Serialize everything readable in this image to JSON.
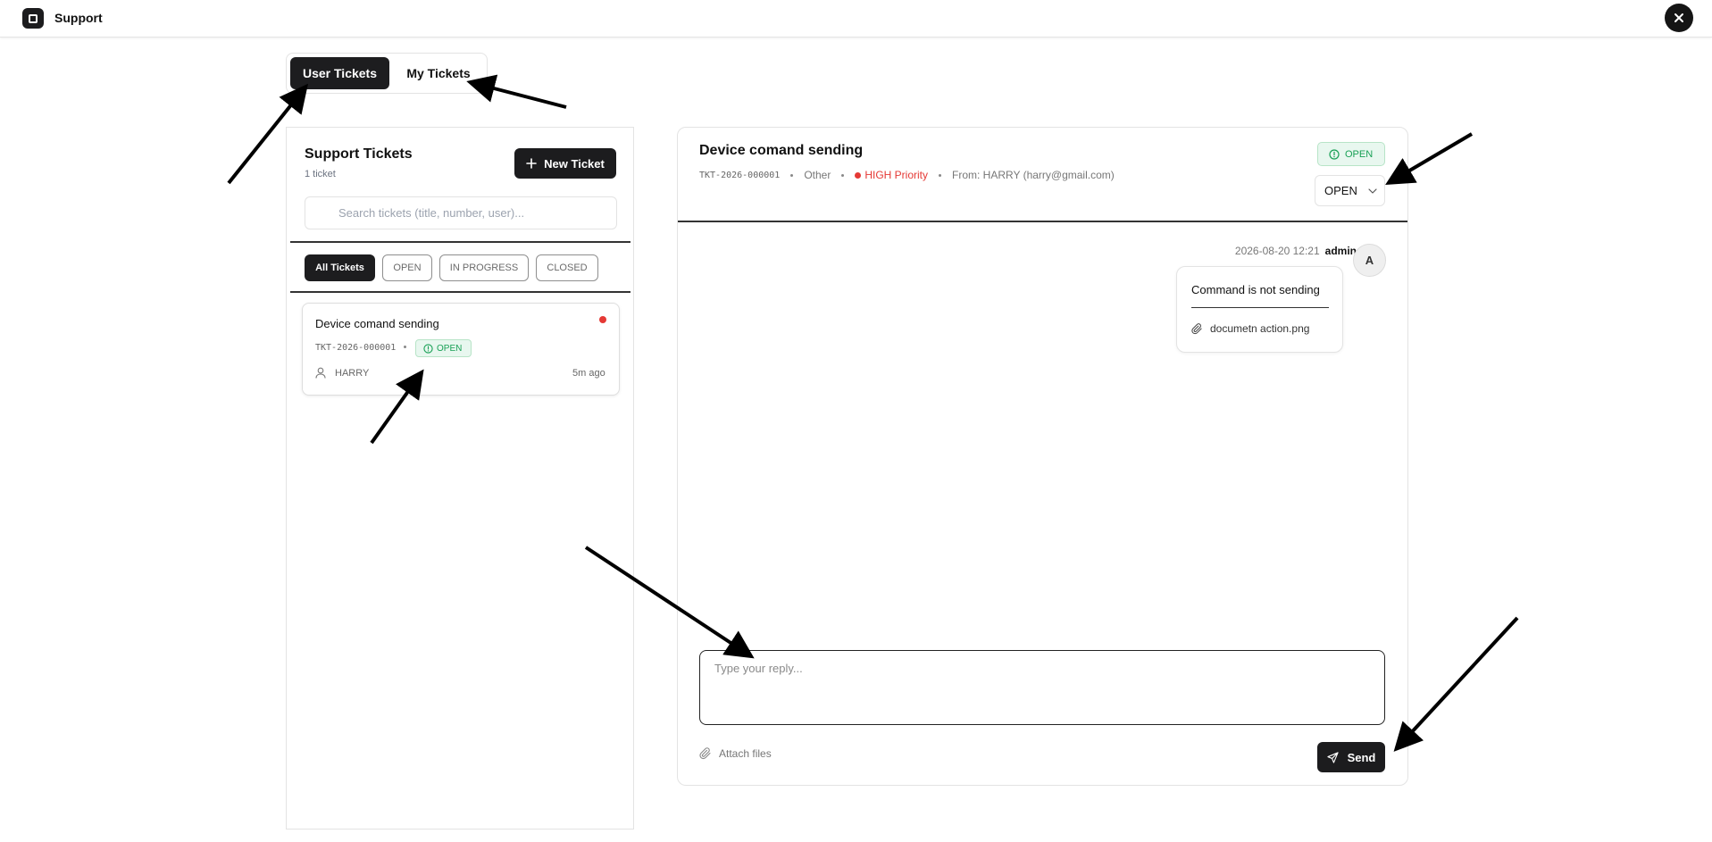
{
  "app": {
    "title": "Support"
  },
  "tabs": [
    {
      "label": "User Tickets",
      "active": true
    },
    {
      "label": "My Tickets",
      "active": false
    }
  ],
  "sidebar": {
    "title": "Support Tickets",
    "count": "1 ticket",
    "new_ticket_label": "New Ticket",
    "search_placeholder": "Search tickets (title, number, user)...",
    "filters": [
      {
        "label": "All Tickets",
        "active": true
      },
      {
        "label": "OPEN",
        "active": false
      },
      {
        "label": "IN PROGRESS",
        "active": false
      },
      {
        "label": "CLOSED",
        "active": false
      }
    ],
    "tickets": [
      {
        "title": "Device comand sending",
        "number": "TKT-2026-000001",
        "status": "OPEN",
        "user": "HARRY",
        "time": "5m ago",
        "priority_color": "#e53935"
      }
    ]
  },
  "detail": {
    "title": "Device comand sending",
    "number": "TKT-2026-000001",
    "category": "Other",
    "priority": "HIGH Priority",
    "from": "From: HARRY (harry@gmail.com)",
    "status_badge": "OPEN",
    "status_select": "OPEN",
    "messages": [
      {
        "timestamp": "2026-08-20 12:21",
        "author": "admin",
        "avatar": "A",
        "text": "Command is not sending",
        "attachment": "documetn action.png"
      }
    ],
    "reply_placeholder": "Type your reply...",
    "attach_label": "Attach files",
    "send_label": "Send"
  },
  "colors": {
    "primary_dark": "#1c1c1e",
    "open_green": "#18a055",
    "open_bg": "#e8f7ef",
    "priority_red": "#e53935"
  },
  "icons": [
    "app-logo-icon",
    "close-icon",
    "plus-icon",
    "search-icon",
    "alert-circle-icon",
    "user-icon",
    "chevron-down-icon",
    "paperclip-icon",
    "send-icon"
  ]
}
